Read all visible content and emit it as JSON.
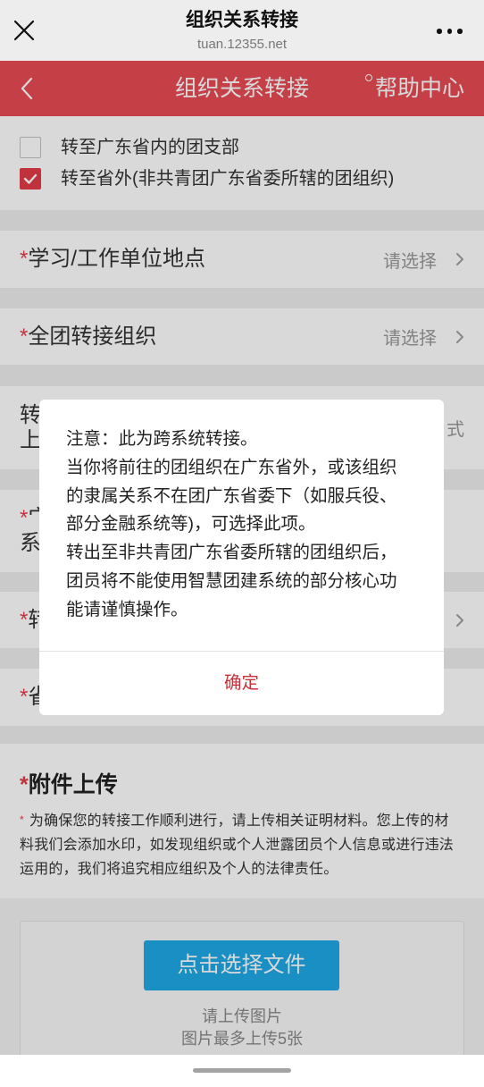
{
  "wechat_bar": {
    "title": "组织关系转接",
    "url": "tuan.12355.net",
    "close_icon": "close-icon",
    "more_icon": "more-icon"
  },
  "header": {
    "back_icon": "chevron-left-icon",
    "title": "组织关系转接",
    "help_icon": "help-circle-icon",
    "help_label": "帮助中心"
  },
  "transfer_options": [
    {
      "label": "转至广东省内的团支部",
      "checked": false
    },
    {
      "label": "转至省外(非共青团广东省委所辖的团组织)",
      "checked": true
    }
  ],
  "form_rows": [
    {
      "required_mark": "*",
      "label": "学习/工作单位地点",
      "placeholder": "请选择"
    },
    {
      "required_mark": "*",
      "label": "全团转接组织",
      "placeholder": "请选择"
    },
    {
      "label_lines": [
        "转",
        "上"
      ],
      "value_fragment": "式"
    },
    {
      "required_mark": "*",
      "label_lines": [
        "宀",
        "系"
      ]
    },
    {
      "required_mark": "*",
      "label": "转"
    },
    {
      "required_mark": "*",
      "label": "省"
    }
  ],
  "attachments": {
    "required_mark": "*",
    "title": "附件上传",
    "note_mark": "*",
    "note_lines": [
      "为确保您的转接工作顺利进行，请上传相关证明材料。您上传的材",
      "料我们会添加水印，如发现组织或个人泄露团员个人信息或进行违法",
      "运用的，我们将追究相应组织及个人的法律责任。"
    ],
    "upload_button": "点击选择文件",
    "hint": "请上传图片",
    "limit": "图片最多上传5张"
  },
  "modal": {
    "message_lines": [
      "注意：此为跨系统转接。",
      "当你将前往的团组织在广东省外，或该组织",
      "的隶属关系不在团广东省委下（如服兵役、",
      "部分金融系统等)，可选择此项。",
      "转出至非共青团广东省委所辖的团组织后，",
      "团员将不能使用智慧团建系统的部分核心功",
      "能请谨慎操作。"
    ],
    "confirm_label": "确定"
  },
  "colors": {
    "header_red": "#e84a54",
    "accent_red": "#e23d47",
    "button_blue": "#1fa9e6",
    "confirm_red": "#c8323c"
  }
}
